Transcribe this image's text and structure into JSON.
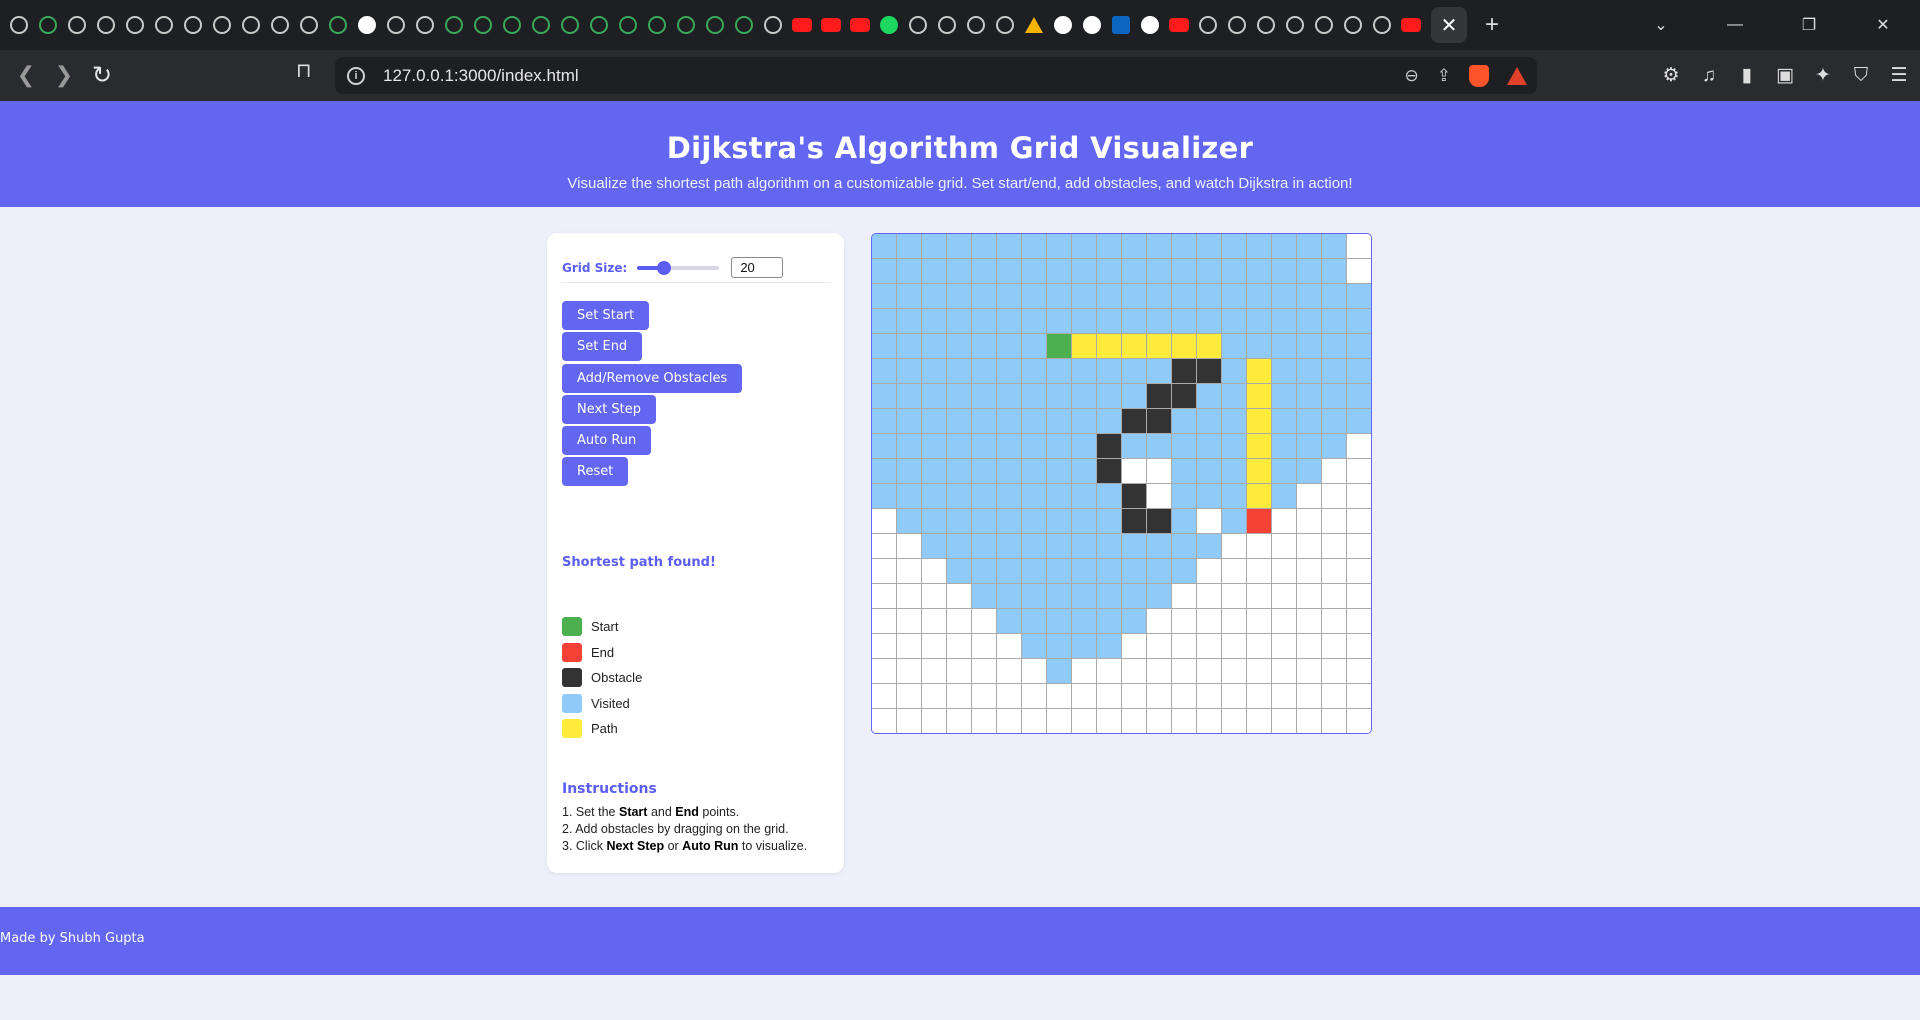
{
  "browser": {
    "url": "127.0.0.1:3000/index.html",
    "tab_close": "✕",
    "new_tab": "+"
  },
  "header": {
    "title": "Dijkstra's Algorithm Grid Visualizer",
    "subtitle": "Visualize the shortest path algorithm on a customizable grid. Set start/end, add obstacles, and watch Dijkstra in action!"
  },
  "controls": {
    "grid_size_label": "Grid Size:",
    "grid_size_value": "20",
    "grid_size_slider_fraction": 0.33,
    "buttons": [
      "Set Start",
      "Set End",
      "Add/Remove Obstacles",
      "Next Step",
      "Auto Run",
      "Reset"
    ],
    "status": "Shortest path found!"
  },
  "legend": [
    {
      "label": "Start",
      "color": "#4caf50"
    },
    {
      "label": "End",
      "color": "#f44336"
    },
    {
      "label": "Obstacle",
      "color": "#333333"
    },
    {
      "label": "Visited",
      "color": "#90caf9"
    },
    {
      "label": "Path",
      "color": "#ffeb3b"
    }
  ],
  "instructions": {
    "title": "Instructions",
    "steps": [
      [
        "1. Set the ",
        "Start",
        " and ",
        "End",
        " points."
      ],
      [
        "2. Add obstacles by dragging on the grid."
      ],
      [
        "3. Click ",
        "Next Step",
        " or ",
        "Auto Run",
        " to visualize."
      ]
    ]
  },
  "grid": {
    "size": 20,
    "legend_codes": {
      ".": "unvisited",
      "v": "visited",
      "S": "start",
      "E": "end",
      "#": "obstacle",
      "P": "path"
    },
    "rows": [
      "vvvvvvvvvvvvvvvvvvv.",
      "vvvvvvvvvvvvvvvvvvv.",
      "vvvvvvvvvvvvvvvvvvvv",
      "vvvvvvvvvvvvvvvvvvvv",
      "vvvvvvvSPPPPPPvvvvvv",
      "vvvvvvvvvvvv##vPvvvv",
      "vvvvvvvvvvv##vvPvvvv",
      "vvvvvvvvvv##vvvPvvvv",
      "vvvvvvvvv#vvvvvPvvv.",
      "vvvvvvvvv#..vvvPvv..",
      "vvvvvvvvvv#.vvvPv...",
      ".vvvvvvvvv##v.vE....",
      "..vvvvvvvvvvvv......",
      "...vvvvvvvvvv.......",
      "....vvvvvvvv........",
      ".....vvvvvv.........",
      "......vvvv..........",
      ".......v............",
      "....................",
      "...................."
    ],
    "colors": {
      "unvisited": "#ffffff",
      "visited": "#90caf9",
      "start": "#4caf50",
      "end": "#f44336",
      "obstacle": "#333333",
      "path": "#ffeb3b"
    }
  },
  "footer": {
    "text": "Made by Shubh Gupta"
  }
}
